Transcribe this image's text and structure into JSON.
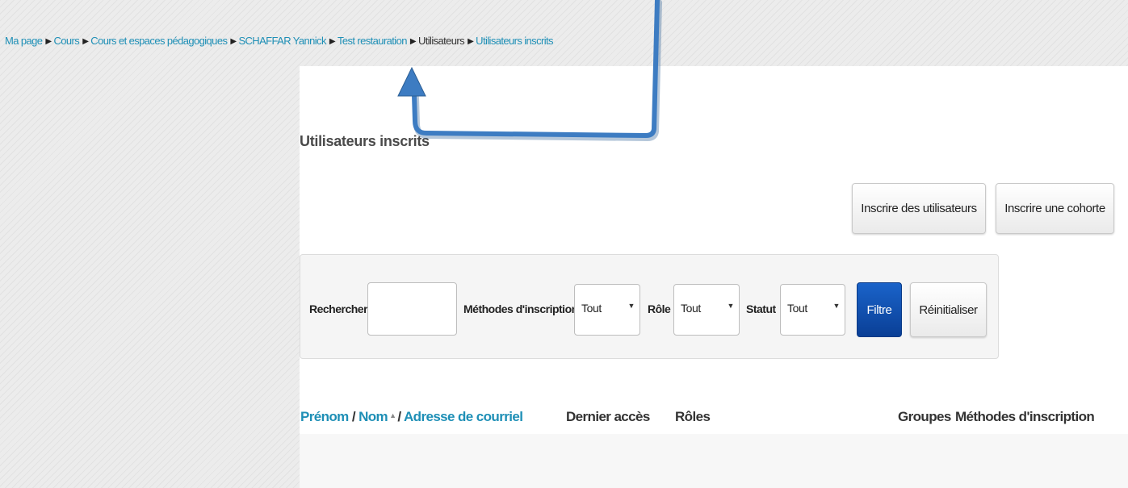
{
  "breadcrumb": [
    {
      "label": "Ma page",
      "link": true
    },
    {
      "label": "Cours",
      "link": true
    },
    {
      "label": "Cours et espaces pédagogiques",
      "link": true
    },
    {
      "label": "SCHAFFAR Yannick",
      "link": true
    },
    {
      "label": "Test restauration",
      "link": true
    },
    {
      "label": "Utilisateurs",
      "link": false
    },
    {
      "label": "Utilisateurs inscrits",
      "link": true
    }
  ],
  "page": {
    "title": "Utilisateurs inscrits"
  },
  "actions": {
    "enrol_users": "Inscrire des utilisateurs",
    "enrol_cohort": "Inscrire une cohorte"
  },
  "filters": {
    "search_label": "Rechercher",
    "search_value": "",
    "methods_label": "Méthodes d'inscription",
    "methods_value": "Tout",
    "role_label": "Rôle",
    "role_value": "Tout",
    "status_label": "Statut",
    "status_value": "Tout",
    "filter_button": "Filtre",
    "reset_button": "Réinitialiser"
  },
  "table": {
    "col_firstname": "Prénom",
    "col_lastname": "Nom",
    "col_email": "Adresse de courriel",
    "col_last_access": "Dernier accès",
    "col_roles": "Rôles",
    "col_groups": "Groupes",
    "col_methods": "Méthodes d'inscription"
  },
  "colors": {
    "link": "#1e8fb6",
    "primary": "#0a4fb0",
    "annotation_arrow": "#3d7cc2"
  },
  "icons": {
    "breadcrumb_separator": "triangle-right-icon",
    "select_caret": "caret-down-icon",
    "sort_indicator": "sort-ascending-icon",
    "annotation": "arrow-annotation-icon"
  }
}
